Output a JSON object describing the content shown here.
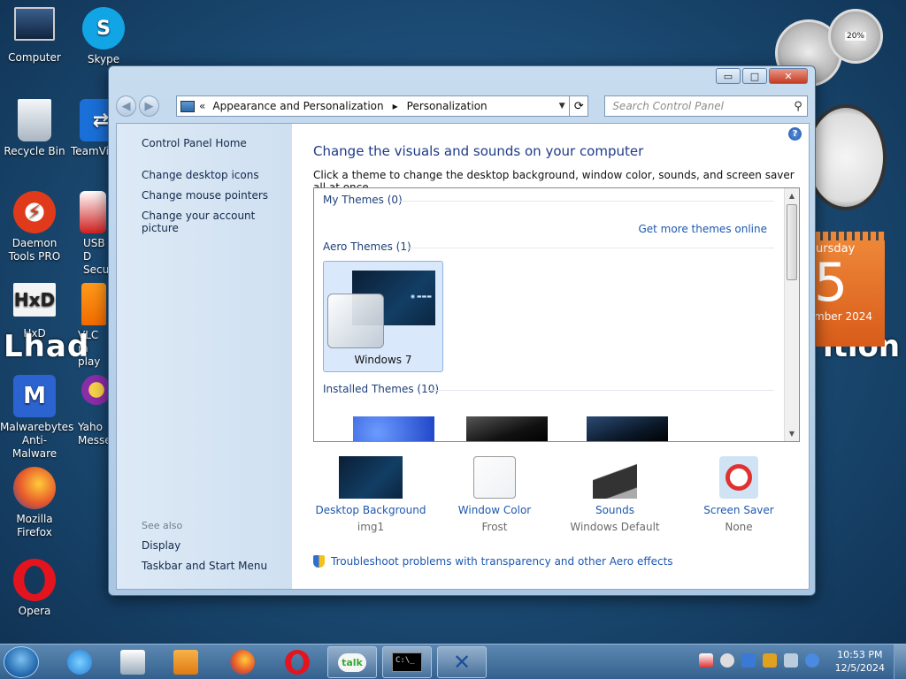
{
  "desktop": {
    "icons": [
      {
        "label": "Computer"
      },
      {
        "label": "Skype"
      },
      {
        "label": "Recycle Bin"
      },
      {
        "label": "TeamVi"
      },
      {
        "label": "Daemon\nTools PRO"
      },
      {
        "label": "USB D\nSecu"
      },
      {
        "label": "HxD"
      },
      {
        "label": "VLC m\nplay"
      },
      {
        "label": "Malwarebytes\nAnti-Malware"
      },
      {
        "label": "Yaho\nMesse"
      },
      {
        "label": "Mozilla\nFirefox"
      },
      {
        "label": "Opera"
      }
    ],
    "watermark_left": "Lhad",
    "watermark_right": "ition",
    "gadgets": {
      "cpu_percent": "20%",
      "calendar_day": "ursday",
      "calendar_number": "5",
      "calendar_month": "mber 2024"
    }
  },
  "window": {
    "caption": {
      "minimize": "▭",
      "maximize": "□",
      "close": "✕"
    },
    "nav": {
      "back": "◀",
      "forward": "▶"
    },
    "address": {
      "chevron": "«",
      "crumbs": [
        "Appearance and Personalization",
        "Personalization"
      ],
      "separator": "▸",
      "dropdown": "▼",
      "refresh": "⟳"
    },
    "search": {
      "placeholder": "Search Control Panel",
      "icon": "⚲"
    },
    "left_pane": {
      "home": "Control Panel Home",
      "links": [
        "Change desktop icons",
        "Change mouse pointers",
        "Change your account picture"
      ],
      "see_also": "See also",
      "see_also_links": [
        "Display",
        "Taskbar and Start Menu"
      ]
    },
    "main": {
      "help": "?",
      "title": "Change the visuals and sounds on your computer",
      "subtitle": "Click a theme to change the desktop background, window color, sounds, and screen saver all at once.",
      "groups": {
        "my_themes": "My Themes (0)",
        "get_more": "Get more themes online",
        "aero_themes": "Aero Themes (1)",
        "selected_theme": "Windows 7",
        "installed_themes": "Installed Themes (10)"
      },
      "scroll": {
        "up": "▲",
        "down": "▼"
      },
      "bottom": [
        {
          "label": "Desktop Background",
          "value": "img1"
        },
        {
          "label": "Window Color",
          "value": "Frost"
        },
        {
          "label": "Sounds",
          "value": "Windows Default"
        },
        {
          "label": "Screen Saver",
          "value": "None"
        }
      ],
      "troubleshoot": "Troubleshoot problems with transparency and other Aero effects"
    }
  },
  "taskbar": {
    "buttons": [
      "ie-icon",
      "windows-media-center-icon",
      "media-player-icon",
      "firefox-icon",
      "opera-icon",
      "talk-icon",
      "cmd-icon",
      "x-app-icon"
    ],
    "talk_label": "talk",
    "cmd_label": "C:\\_",
    "time": "10:53 PM",
    "date": "12/5/2024"
  },
  "colors": {
    "link": "#1d57b0",
    "title": "#1e3a8a",
    "taskbar": "#33608e"
  }
}
